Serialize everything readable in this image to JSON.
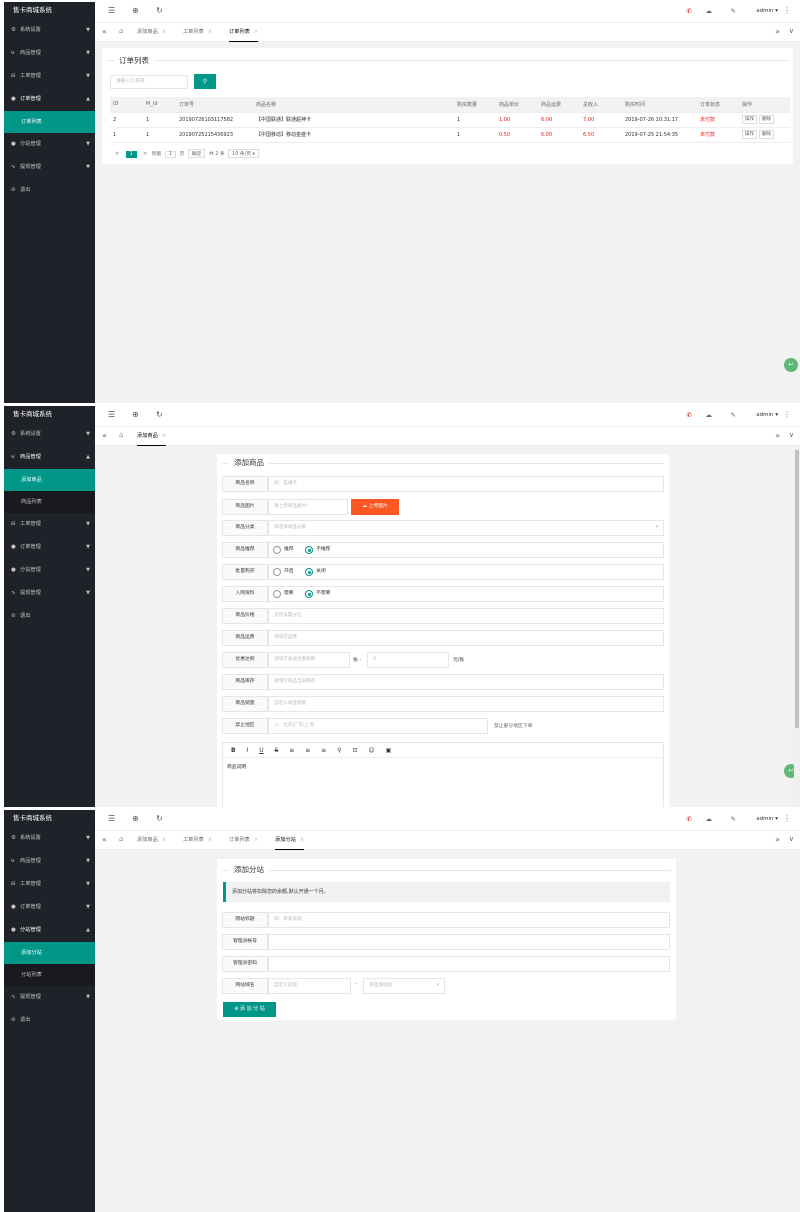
{
  "app": {
    "title": "售卡商城系统",
    "admin": "admin"
  },
  "icons": {
    "menu": "menu-icon",
    "globe": "globe-icon",
    "refresh": "refresh-icon",
    "home": "home-icon",
    "more": "more-vertical-icon"
  },
  "colors": {
    "sidebar": "#20222a",
    "accent": "#009688",
    "danger": "#e02020",
    "orange": "#ff5722"
  },
  "screen1": {
    "nav": [
      "系统设置",
      "商品管理",
      "工单管理",
      "订单管理",
      "分站管理",
      "提现管理",
      "退出"
    ],
    "sub_nav": [
      "订单列表"
    ],
    "tabs": [
      "添加商品",
      "工单列表",
      "订单列表"
    ],
    "legend": "订单列表",
    "search_placeholder": "请输入订单号",
    "columns": [
      "ID",
      "M_id",
      "订单号",
      "商品名称",
      "购买数量",
      "商品单价",
      "商品运费",
      "总收入",
      "购买时间",
      "订单状态",
      "操作"
    ],
    "rows": [
      [
        "2",
        "1",
        "201907261031175​82",
        "【中国联通】联通超神卡",
        "1",
        "1.00",
        "6.00",
        "7.00",
        "2019-07-26 10:31:17",
        "未付款"
      ],
      [
        "1",
        "1",
        "20190725215436923",
        "【中国移动】移动金盛卡",
        "1",
        "0.50",
        "6.00",
        "6.50",
        "2019-07-25 21:54:35",
        "未付款"
      ]
    ],
    "row_buttons": [
      "操作",
      "删除"
    ],
    "pager": {
      "prev": "<",
      "current": "1",
      "next": ">",
      "goto": "到第",
      "page_input": "1",
      "page_unit": "页",
      "confirm": "确定",
      "total": "共 2 条",
      "per_page": "10 条/页"
    }
  },
  "screen2": {
    "nav": [
      "系统设置",
      "商品管理",
      "工单管理",
      "订单管理",
      "分站管理",
      "提现管理",
      "退出"
    ],
    "sub_nav": [
      "添加商品",
      "商品列表"
    ],
    "tabs": [
      "添加商品"
    ],
    "legend": "添加商品",
    "fields": {
      "name": {
        "label": "商品名称",
        "placeholder": "如：蓝满卡"
      },
      "image": {
        "label": "商品图片",
        "placeholder": "请上传商品图片!",
        "button": "上传图片"
      },
      "category": {
        "label": "商品分类",
        "placeholder": "请选择商品分类"
      },
      "recommend": {
        "label": "商品推荐",
        "options": [
          "推荐",
          "不推荐"
        ],
        "selected": 1
      },
      "bulk": {
        "label": "批量购买",
        "options": [
          "开启",
          "关闭"
        ],
        "selected": 1
      },
      "netinfo": {
        "label": "入网资料",
        "options": [
          "需要",
          "不需要"
        ],
        "selected": 1
      },
      "price": {
        "label": "商品价格",
        "placeholder": "支持设置分红"
      },
      "shipping": {
        "label": "商品运费",
        "placeholder": "请填写运费"
      },
      "discount": {
        "label": "优惠达到",
        "placeholder": "请填写发送优惠张数",
        "mid_unit": "张 -",
        "second_placeholder": "0",
        "end_unit": "元/张"
      },
      "stock": {
        "label": "商品库存",
        "placeholder": "请填写商品当前库存"
      },
      "sales": {
        "label": "商品销量",
        "placeholder": "自定义商品销量"
      },
      "forbid": {
        "label": "禁止地区",
        "placeholder": "入：北京|广东|上海",
        "note": "禁止部分地区下单"
      }
    },
    "editor": {
      "toolbar": [
        "B",
        "I",
        "U",
        "S",
        "≡",
        "≡",
        "≡",
        "⚲",
        "⊡",
        "☺",
        "▣"
      ],
      "body": "商品说明"
    }
  },
  "screen3": {
    "nav": [
      "系统设置",
      "商品管理",
      "工单管理",
      "订单管理",
      "分站管理",
      "提现管理",
      "退出"
    ],
    "sub_nav": [
      "添加分站",
      "分站列表"
    ],
    "tabs": [
      "添加商品",
      "工单列表",
      "订单列表",
      "添加分站"
    ],
    "legend": "添加分站",
    "notice": "添加分站将扣除您的余额,默认开通一个月。",
    "fields": {
      "site_title": {
        "label": "网站标题",
        "placeholder": "如：某某商城"
      },
      "admin_account": {
        "label": "管理员帐号",
        "placeholder": ""
      },
      "admin_password": {
        "label": "管理员密码",
        "placeholder": ""
      },
      "domain": {
        "label": "网站域名",
        "placeholder": "自定义前缀",
        "separator": "-",
        "select_placeholder": "请选择后缀"
      }
    },
    "submit": "添 加 分 站"
  }
}
